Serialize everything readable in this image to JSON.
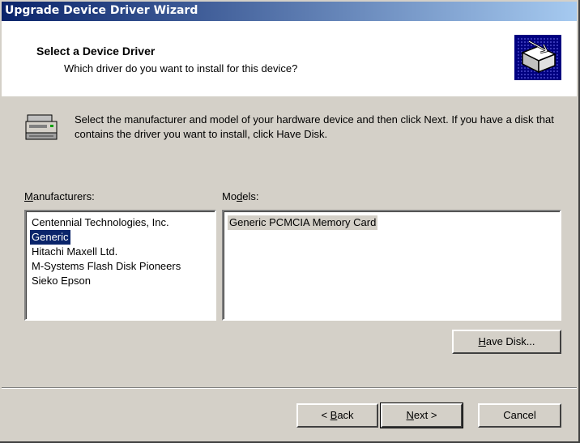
{
  "window": {
    "title": "Upgrade Device Driver Wizard"
  },
  "header": {
    "title": "Select a Device Driver",
    "subtitle": "Which driver do you want to install for this device?"
  },
  "instructions": "Select the manufacturer and model of your hardware device and then click Next. If you have a disk that contains the driver you want to install, click Have Disk.",
  "manufacturers": {
    "label_hotkey": "M",
    "label_rest": "anufacturers:",
    "items": [
      "Centennial Technologies, Inc.",
      "Generic",
      "Hitachi Maxell Ltd.",
      "M-Systems Flash Disk Pioneers",
      "Sieko Epson"
    ],
    "selected": "Generic"
  },
  "models": {
    "label_pre": "Mo",
    "label_hotkey": "d",
    "label_rest": "els:",
    "items": [
      "Generic PCMCIA Memory Card"
    ],
    "selected": "Generic PCMCIA Memory Card"
  },
  "buttons": {
    "have_disk": {
      "hotkey": "H",
      "rest": "ave Disk..."
    },
    "back": {
      "pre": "< ",
      "hotkey": "B",
      "rest": "ack"
    },
    "next": {
      "hotkey": "N",
      "rest": "ext >"
    },
    "cancel": "Cancel"
  },
  "icons": {
    "wizard": "hardware-wizard-icon",
    "printer": "printer-icon"
  },
  "colors": {
    "titlebar": "#0a246a",
    "selection": "#0a246a",
    "face": "#d4d0c8"
  }
}
